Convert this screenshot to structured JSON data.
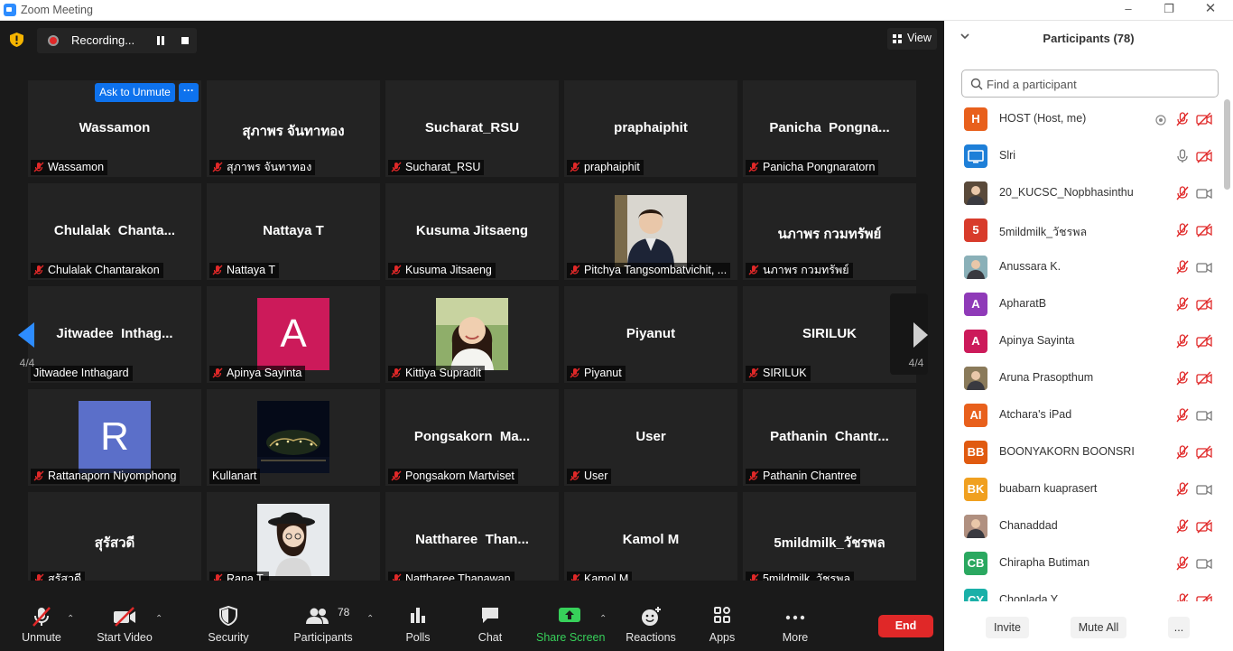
{
  "window": {
    "title": "Zoom Meeting"
  },
  "recording": {
    "label": "Recording..."
  },
  "view": {
    "label": "View"
  },
  "ask_unmute": {
    "label": "Ask to Unmute",
    "more": "···"
  },
  "pager": {
    "left": "4/4",
    "right": "4/4"
  },
  "tiles": [
    {
      "big": "Wassamon",
      "label": "Wassamon",
      "muted": true
    },
    {
      "big": "สุภาพร จันทาทอง",
      "label": "สุภาพร จันทาทอง",
      "muted": true
    },
    {
      "big": "Sucharat_RSU",
      "label": "Sucharat_RSU",
      "muted": true
    },
    {
      "big": "praphaiphit",
      "label": "praphaiphit",
      "muted": true
    },
    {
      "big": "Panicha  Pongna...",
      "label": "Panicha Pongnaratorn",
      "muted": true
    },
    {
      "big": "Chulalak  Chanta...",
      "label": "Chulalak Chantarakon",
      "muted": true
    },
    {
      "big": "Nattaya T",
      "label": "Nattaya T",
      "muted": true
    },
    {
      "big": "Kusuma Jitsaeng",
      "label": "Kusuma Jitsaeng",
      "muted": true
    },
    {
      "big": "",
      "label": "Pitchya Tangsombatvichit, ...",
      "muted": true,
      "photo": "woman-in-blazer"
    },
    {
      "big": "นภาพร กวมทรัพย์",
      "label": "นภาพร กวมทรัพย์",
      "muted": true
    },
    {
      "big": "Jitwadee  Inthag...",
      "label": "Jitwadee Inthagard",
      "muted": false
    },
    {
      "big": "",
      "label": "Apinya Sayinta",
      "muted": true,
      "letter": "A",
      "color": "#cc1a5a"
    },
    {
      "big": "",
      "label": "Kittiya Supradit",
      "muted": true,
      "photo": "smiling-woman"
    },
    {
      "big": "Piyanut",
      "label": "Piyanut",
      "muted": true
    },
    {
      "big": "SIRILUK",
      "label": "SIRILUK",
      "muted": true
    },
    {
      "big": "",
      "label": "Rattanaporn Niyomphong",
      "muted": true,
      "letter": "R",
      "color": "#5b6fc9"
    },
    {
      "big": "",
      "label": "Kullanart",
      "muted": false,
      "photo": "night-tree"
    },
    {
      "big": "Pongsakorn  Ma...",
      "label": "Pongsakorn Martviset",
      "muted": true
    },
    {
      "big": "User",
      "label": "User",
      "muted": true
    },
    {
      "big": "Pathanin  Chantr...",
      "label": "Pathanin Chantree",
      "muted": true
    },
    {
      "big": "สุรัสวดี",
      "label": "สุรัสวดี",
      "muted": true
    },
    {
      "big": "",
      "label": "Rana T.",
      "muted": true,
      "photo": "woman-with-hat"
    },
    {
      "big": "Nattharee  Than...",
      "label": "Nattharee Thanawan",
      "muted": true
    },
    {
      "big": "Kamol M",
      "label": "Kamol M",
      "muted": true
    },
    {
      "big": "5mildmilk_วัชรพล",
      "label": "5mildmilk_วัชรพล",
      "muted": true
    }
  ],
  "toolbar": {
    "unmute": "Unmute",
    "start_video": "Start Video",
    "security": "Security",
    "participants": "Participants",
    "participants_count": "78",
    "polls": "Polls",
    "chat": "Chat",
    "share_screen": "Share Screen",
    "reactions": "Reactions",
    "apps": "Apps",
    "more": "More",
    "end": "End"
  },
  "panel": {
    "title": "Participants (78)",
    "search_placeholder": "Find a participant",
    "invite": "Invite",
    "mute_all": "Mute All",
    "more": "..."
  },
  "participants": [
    {
      "name": "HOST (Host, me)",
      "avatar": "H",
      "color": "#e8601c",
      "mic": "muted",
      "video": "off",
      "rec": true
    },
    {
      "name": "Slri",
      "avatar": "",
      "color": "#1e7fd8",
      "mic": "on",
      "video": "off",
      "icon": "monitor-icon"
    },
    {
      "name": "20_KUCSC_Nopbhasinthu",
      "avatar": "",
      "color": "#5a4a3a",
      "mic": "muted",
      "video": "on",
      "photo": true
    },
    {
      "name": "5mildmilk_วัชรพล",
      "avatar": "5",
      "color": "#d83b2b",
      "mic": "muted",
      "video": "off"
    },
    {
      "name": "Anussara K.",
      "avatar": "",
      "color": "#8ab0b8",
      "mic": "muted",
      "video": "on",
      "photo": true
    },
    {
      "name": "ApharatB",
      "avatar": "A",
      "color": "#8f3ab8",
      "mic": "muted",
      "video": "off"
    },
    {
      "name": "Apinya Sayinta",
      "avatar": "A",
      "color": "#cc1a5a",
      "mic": "muted",
      "video": "off"
    },
    {
      "name": "Aruna Prasopthum",
      "avatar": "",
      "color": "#8a7a5a",
      "mic": "muted",
      "video": "off",
      "photo": true
    },
    {
      "name": "Atchara's iPad",
      "avatar": "AI",
      "color": "#e8601c",
      "mic": "muted",
      "video": "on"
    },
    {
      "name": "BOONYAKORN BOONSRI",
      "avatar": "BB",
      "color": "#e05a10",
      "mic": "muted",
      "video": "off"
    },
    {
      "name": "buabarn kuaprasert",
      "avatar": "BK",
      "color": "#f0a020",
      "mic": "muted",
      "video": "on"
    },
    {
      "name": "Chanaddad",
      "avatar": "",
      "color": "#b09080",
      "mic": "muted",
      "video": "off",
      "photo": true
    },
    {
      "name": "Chirapha Butiman",
      "avatar": "CB",
      "color": "#2aa860",
      "mic": "muted",
      "video": "on"
    },
    {
      "name": "Chonlada Y.",
      "avatar": "CY",
      "color": "#1ab0a8",
      "mic": "muted",
      "video": "off"
    }
  ]
}
